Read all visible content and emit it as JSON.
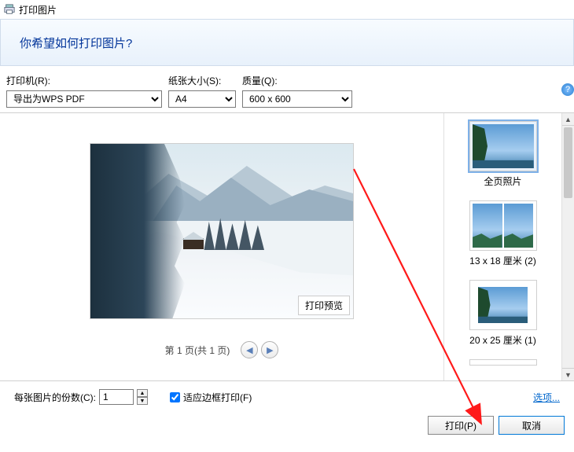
{
  "window": {
    "title": "打印图片"
  },
  "header": {
    "question": "你希望如何打印图片?"
  },
  "controls": {
    "printer": {
      "label": "打印机(R):",
      "value": "导出为WPS PDF"
    },
    "paper": {
      "label": "纸张大小(S):",
      "value": "A4"
    },
    "quality": {
      "label": "质量(Q):",
      "value": "600 x 600"
    }
  },
  "preview": {
    "tag": "打印预览",
    "page_label": "第 1 页(共 1 页)"
  },
  "layouts": {
    "items": [
      {
        "label": "全页照片",
        "style": "full",
        "selected": true
      },
      {
        "label": "13 x 18 厘米 (2)",
        "style": "half",
        "selected": false
      },
      {
        "label": "20 x 25 厘米 (1)",
        "style": "single-small",
        "selected": false
      },
      {
        "label": "",
        "style": "partial-row",
        "selected": false
      }
    ]
  },
  "footer": {
    "copies_label": "每张图片的份数(C):",
    "copies_value": "1",
    "fit_label": "适应边框打印(F)",
    "fit_checked": true,
    "options_link": "选项..."
  },
  "actions": {
    "print": "打印(P)",
    "cancel": "取消"
  }
}
